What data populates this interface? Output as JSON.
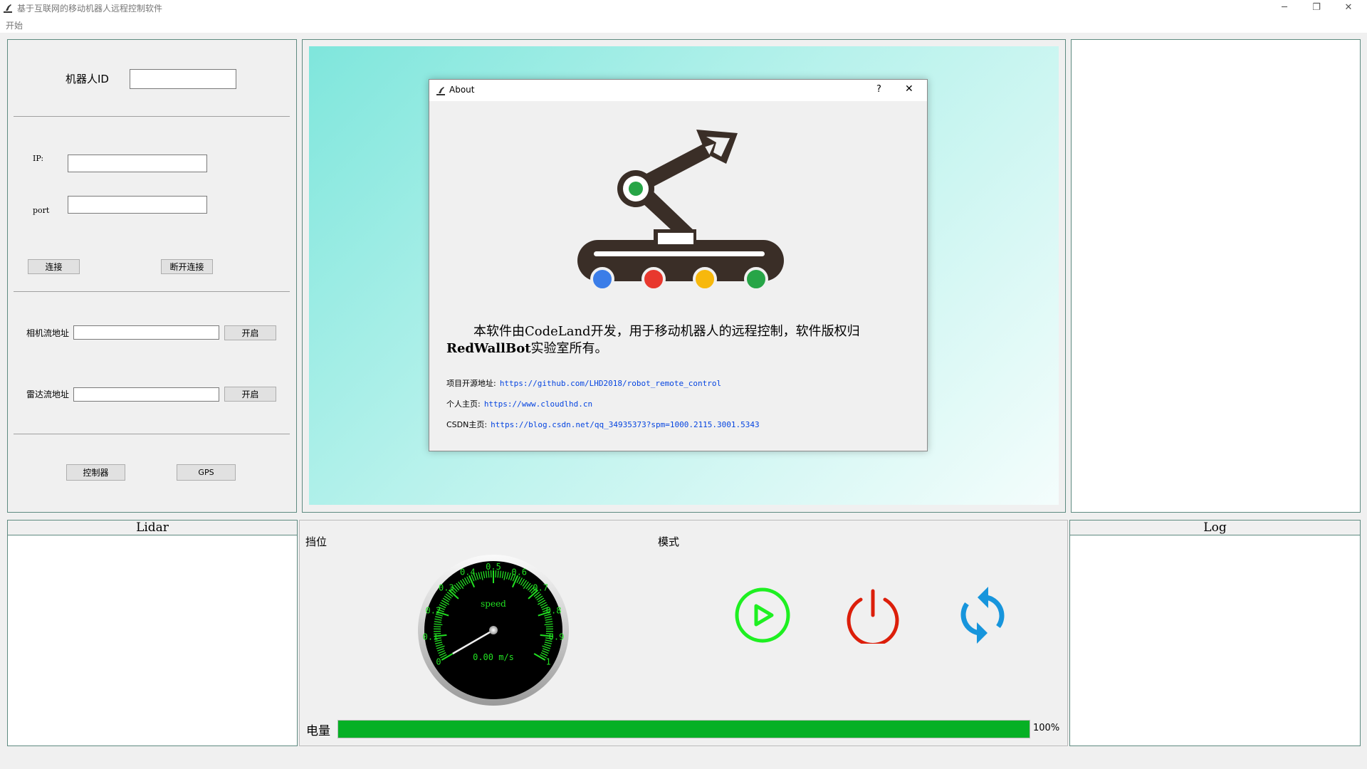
{
  "window": {
    "title": "基于互联网的移动机器人远程控制软件",
    "minimize": "─",
    "restore": "❐",
    "close": "✕"
  },
  "menu": {
    "start": "开始"
  },
  "left": {
    "robot_id_label": "机器人ID",
    "robot_id_value": "",
    "ip_label": "IP:",
    "ip_value": "",
    "port_label": "port",
    "port_value": "",
    "connect": "连接",
    "disconnect": "断开连接",
    "camera_label": "相机流地址",
    "camera_value": "",
    "camera_open": "开启",
    "radar_label": "雷达流地址",
    "radar_value": "",
    "radar_open": "开启",
    "controller": "控制器",
    "gps": "GPS"
  },
  "about": {
    "title": "About",
    "help": "?",
    "close": "✕",
    "desc1": "本软件由CodeLand开发，用于移动机器人的远程控制，软件版权归",
    "desc2_bold": "RedWallBot",
    "desc2": "实验室所有。",
    "repo_label": "项目开源地址:",
    "repo_url": "https://github.com/LHD2018/robot_remote_control",
    "home_label": "个人主页:",
    "home_url": "https://www.cloudlhd.cn",
    "csdn_label": "CSDN主页:",
    "csdn_url": "https://blog.csdn.net/qq_34935373?spm=1000.2115.3001.5343",
    "wheel_colors": [
      "#3b7de8",
      "#e8382e",
      "#f7b80c",
      "#27a547"
    ]
  },
  "bottom": {
    "lidar_title": "Lidar",
    "log_title": "Log",
    "gear_label": "挡位",
    "mode_label": "模式",
    "battery_label": "电量",
    "battery_percent": 100,
    "battery_text": "100%",
    "play_color": "#1ef021",
    "power_color": "#dc1e0a",
    "refresh_color": "#1795dc"
  },
  "gauge": {
    "title": "speed",
    "value": 0.0,
    "value_text": "0.00 m/s",
    "min": 0,
    "max": 1,
    "tick_labels": [
      "0",
      "0.1",
      "0.2",
      "0.3",
      "0.4",
      "0.5",
      "0.6",
      "0.7",
      "0.8",
      "0.9",
      "1"
    ],
    "color": "#22e022"
  }
}
